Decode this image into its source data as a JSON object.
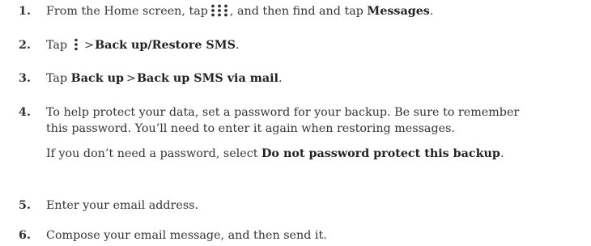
{
  "steps": [
    {
      "number": "1.",
      "t1": "From the Home screen, tap",
      "icon": "apps-grid-icon",
      "t2": ", and then find and tap",
      "b1": "Messages",
      "end": "."
    },
    {
      "number": "2.",
      "t1": "Tap",
      "icon": "overflow-menu-icon",
      "sep": ">",
      "b1": "Back up/Restore SMS",
      "end": "."
    },
    {
      "number": "3.",
      "t1": "Tap",
      "b1": "Back up",
      "sep": ">",
      "b2": "Back up SMS via mail",
      "end": "."
    },
    {
      "number": "4.",
      "text": "To help protect your data, set a password for your backup. Be sure to remember this password. You’ll need to enter it again when restoring messages.",
      "note_t1": "If you don’t need a password, select",
      "note_b1": "Do not password protect this backup",
      "note_end": "."
    },
    {
      "number": "5.",
      "text": "Enter your email address."
    },
    {
      "number": "6.",
      "text": "Compose your email message, and then send it."
    }
  ]
}
